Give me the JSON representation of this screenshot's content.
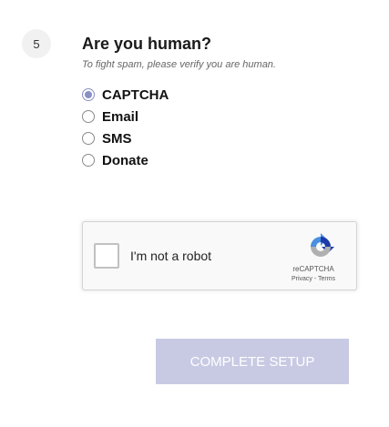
{
  "step": {
    "number": "5",
    "title": "Are you human?",
    "subtitle": "To fight spam, please verify you are human."
  },
  "options": [
    {
      "label": "CAPTCHA",
      "selected": true
    },
    {
      "label": "Email",
      "selected": false
    },
    {
      "label": "SMS",
      "selected": false
    },
    {
      "label": "Donate",
      "selected": false
    }
  ],
  "recaptcha": {
    "label": "I'm not a robot",
    "brand": "reCAPTCHA",
    "privacy": "Privacy",
    "separator": " - ",
    "terms": "Terms",
    "checked": false,
    "logo_icon": "recaptcha-logo-icon"
  },
  "complete_button": {
    "label": "COMPLETE SETUP",
    "disabled": true,
    "color": "#c8cae4"
  },
  "colors": {
    "accent": "#8a8fc6",
    "badge_bg": "#f1f1f1"
  }
}
